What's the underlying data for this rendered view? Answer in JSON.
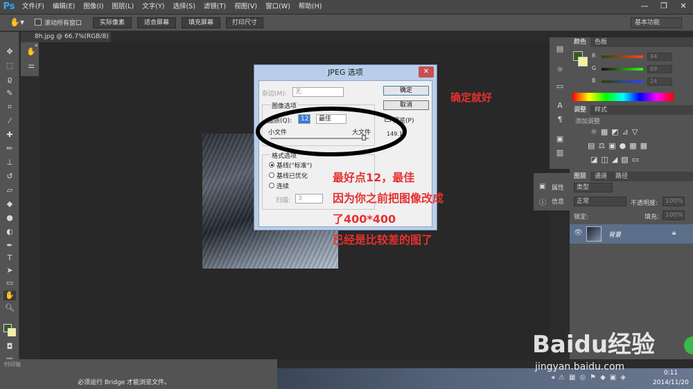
{
  "app": {
    "logo": "Ps"
  },
  "menu": [
    "文件(F)",
    "编辑(E)",
    "图像(I)",
    "图层(L)",
    "文字(Y)",
    "选择(S)",
    "滤镜(T)",
    "视图(V)",
    "窗口(W)",
    "帮助(H)"
  ],
  "window_controls": [
    "—",
    "❐",
    "✕"
  ],
  "options": {
    "scroll_all": "滚动所有窗口",
    "buttons": [
      "实际像素",
      "适合屏幕",
      "填充屏幕",
      "打印尺寸"
    ],
    "workspace": "基本功能"
  },
  "document": {
    "tab": "8h.jpg @ 66.7%(RGB/8) *"
  },
  "dialog": {
    "title": "JPEG 选项",
    "matte_label": "杂边(M):",
    "matte_value": "无",
    "ok": "确定",
    "cancel": "取消",
    "image_options": "图像选项",
    "quality_label": "品质(Q):",
    "quality_value": "12",
    "quality_preset": "最佳",
    "small_file": "小文件",
    "large_file": "大文件",
    "preview_label": "预览(P)",
    "file_size": "149.1K",
    "format_options": "格式选项",
    "baseline_std": "基线(\"标准\")",
    "baseline_opt": "基线已优化",
    "progressive": "连续",
    "scans_label": "扫描:",
    "scans_value": "3"
  },
  "annotations": {
    "ok_note": "确定就好",
    "line1": "最好点12，最佳",
    "line2": "因为你之前把图像改成",
    "line3": "了400*400",
    "line4": "已经是比较差的图了"
  },
  "panels": {
    "color_tabs": [
      "颜色",
      "色板"
    ],
    "r_label": "R",
    "g_label": "G",
    "b_label": "B",
    "r": "44",
    "g": "69",
    "b": "24",
    "adjust_tabs": [
      "调整",
      "样式"
    ],
    "add_adjustment": "添加调整",
    "props": "属性",
    "info": "信息",
    "layer_tabs": [
      "图层",
      "通道",
      "路径"
    ],
    "kind": "类型",
    "blend": "正常",
    "opacity_label": "不透明度:",
    "opacity": "100%",
    "lock_label": "锁定:",
    "fill_label": "填充:",
    "fill": "100%",
    "layer_name": "背景"
  },
  "bottom": {
    "timeline": "时间轴",
    "bridge_msg": "必须运行 Bridge 才能浏览文件。"
  },
  "taskbar": {
    "time": "0:11",
    "date": "2014/11/20"
  },
  "watermark": {
    "brand": "Baidu经验",
    "url": "jingyan.baidu.com"
  },
  "colors": {
    "accent_red": "#e83030",
    "ps_blue": "#32a6ff",
    "fg": "#3a5a27",
    "bg": "#f4f19a"
  }
}
